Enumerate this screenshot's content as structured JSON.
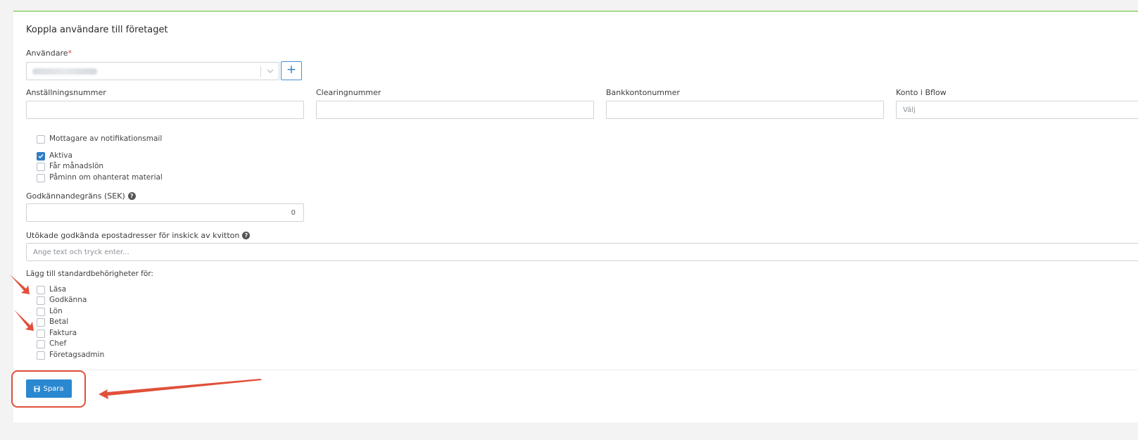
{
  "form": {
    "title": "Koppla användare till företaget",
    "user_label": "Användare",
    "required_mark": "*",
    "add_button_label": "+",
    "fields": [
      {
        "label": "Anställningsnummer",
        "value": ""
      },
      {
        "label": "Clearingnummer",
        "value": ""
      },
      {
        "label": "Bankkontonummer",
        "value": ""
      },
      {
        "label": "Konto i Bflow",
        "placeholder": "Välj"
      }
    ],
    "checkboxes": [
      {
        "label": "Mottagare av notifikationsmail",
        "checked": false
      },
      {
        "label": "Aktiva",
        "checked": true
      },
      {
        "label": "Får månadslön",
        "checked": false
      },
      {
        "label": "Påminn om ohanterat material",
        "checked": false
      }
    ],
    "limit_label": "Godkännandegräns (SEK)",
    "limit_value": "0",
    "emails_label": "Utökade godkända epostadresser för inskick av kvitton",
    "emails_placeholder": "Ange text och tryck enter...",
    "permissions_label": "Lägg till standardbehörigheter för:",
    "permissions": [
      {
        "label": "Läsa",
        "checked": false
      },
      {
        "label": "Godkänna",
        "checked": false
      },
      {
        "label": "Lön",
        "checked": false
      },
      {
        "label": "Betal",
        "checked": false
      },
      {
        "label": "Faktura",
        "checked": false
      },
      {
        "label": "Chef",
        "checked": false
      },
      {
        "label": "Företagsadmin",
        "checked": false
      }
    ],
    "save_label": "Spara"
  },
  "colors": {
    "accent": "#2a88d0",
    "annotation": "#e0503a",
    "top_border": "#a5d98a"
  }
}
